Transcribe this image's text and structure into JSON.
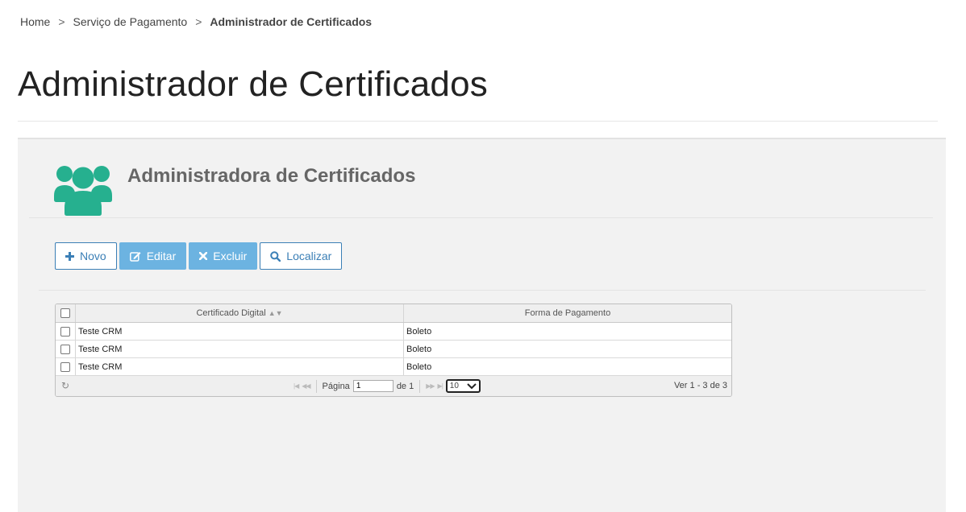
{
  "breadcrumb": {
    "items": [
      "Home",
      "Serviço de Pagamento"
    ],
    "separator": ">",
    "current": "Administrador de Certificados"
  },
  "page": {
    "title": "Administrador de Certificados"
  },
  "panel": {
    "title": "Administradora de Certificados",
    "icon": "users-group-icon",
    "icon_color": "#26b08f"
  },
  "toolbar": {
    "novo": "Novo",
    "editar": "Editar",
    "excluir": "Excluir",
    "localizar": "Localizar"
  },
  "grid": {
    "columns": [
      "Certificado Digital",
      "Forma de Pagamento"
    ],
    "rows": [
      {
        "certificado": "Teste CRM",
        "forma": "Boleto"
      },
      {
        "certificado": "Teste CRM",
        "forma": "Boleto"
      },
      {
        "certificado": "Teste CRM",
        "forma": "Boleto"
      }
    ],
    "pager": {
      "page_label": "Página",
      "page_value": "1",
      "of_label": "de 1",
      "page_size": "10",
      "info": "Ver 1 - 3 de 3"
    }
  },
  "colors": {
    "accent": "#3b7fb6",
    "button_solid": "#6cb3e1",
    "panel_bg": "#f2f2f2"
  }
}
